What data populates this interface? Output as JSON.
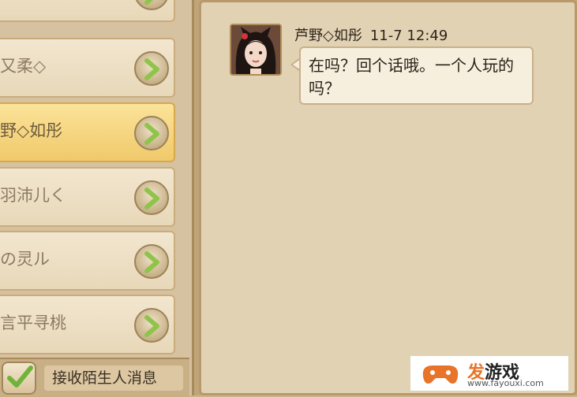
{
  "contacts": [
    {
      "name": "",
      "selected": false
    },
    {
      "name": "又柔◇",
      "selected": false
    },
    {
      "name": "野◇如彤",
      "selected": true
    },
    {
      "name": "羽沛儿く",
      "selected": false
    },
    {
      "name": "の灵ル",
      "selected": false
    },
    {
      "name": "言平寻桃",
      "selected": false
    }
  ],
  "bottom_bar": {
    "accept_strangers_label": "接收陌生人消息",
    "checked": true
  },
  "chat": {
    "sender": "芦野◇如彤",
    "time": "11-7 12:49",
    "message": "在吗？回个话哦。一个人玩的吗？"
  },
  "watermark": {
    "brand_highlight": "发",
    "brand_rest": "游戏",
    "url": "www.fayouxi.com"
  },
  "colors": {
    "selected_row": "#f0c96a",
    "button_arrow": "#8fc44a",
    "panel_bg": "#e2d2b4"
  }
}
